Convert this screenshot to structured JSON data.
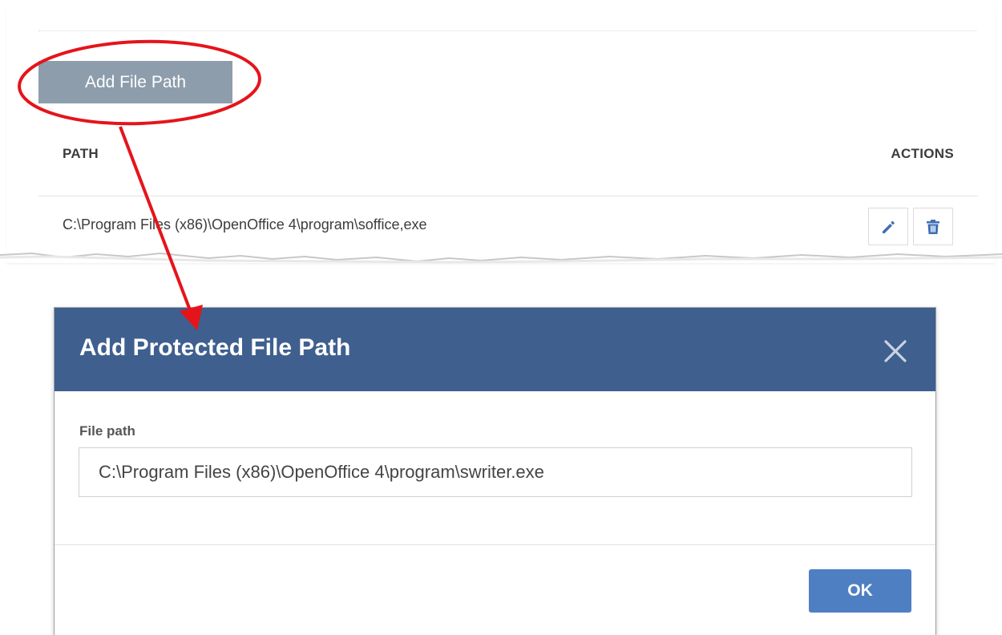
{
  "top_panel": {
    "add_button_label": "Add File Path",
    "columns": {
      "path": "PATH",
      "actions": "ACTIONS"
    },
    "rows": [
      {
        "path": "C:\\Program Files (x86)\\OpenOffice 4\\program\\soffice,exe",
        "actions": [
          "edit-icon",
          "trash-icon"
        ]
      }
    ]
  },
  "modal": {
    "title": "Add Protected File Path",
    "close_icon": "close-icon",
    "field_label": "File path",
    "field_value": "C:\\Program Files (x86)\\OpenOffice 4\\program\\swriter.exe",
    "ok_label": "OK"
  },
  "colors": {
    "add_button_bg": "#8d9dac",
    "modal_header_bg": "#3f5f8f",
    "ok_button_bg": "#4e7fc3",
    "action_icon": "#3f6fb5",
    "annotation_red": "#e5141b"
  }
}
